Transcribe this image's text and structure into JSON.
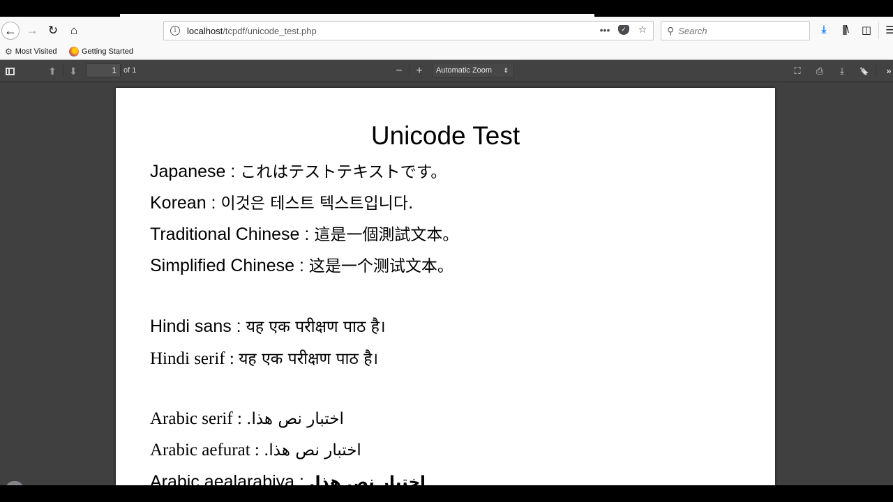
{
  "browser": {
    "url_host": "localhost",
    "url_path": "/tcpdf/unicode_test.php",
    "search_placeholder": "Search",
    "icons": {
      "back": "←",
      "forward": "→",
      "reload": "↻",
      "home": "⌂",
      "page_actions": "•••",
      "pocket": "✓",
      "star": "☆",
      "search": "⚲",
      "download": "⤓",
      "library": "|||\\",
      "sidebar": "◫",
      "menu": "☰"
    },
    "bookmarks": [
      {
        "label": "Most Visited",
        "icon": "⚙"
      },
      {
        "label": "Getting Started",
        "icon": "firefox"
      }
    ]
  },
  "pdf_viewer": {
    "page_number": "1",
    "page_count_label": "of 1",
    "zoom_label": "Automatic Zoom",
    "icons": {
      "prev": "⬆",
      "next": "⬇",
      "zoom_out": "−",
      "zoom_in": "+",
      "zoom_arrows": "⇕",
      "presentation": "⛶",
      "print": "⎙",
      "save": "⤓",
      "bookmark": "🔖",
      "tools": "»"
    }
  },
  "document": {
    "title": "Unicode Test",
    "lines": [
      {
        "label": "Japanese : ",
        "text": "これはテストテキストです。"
      },
      {
        "label": "Korean : ",
        "text": "이것은 테스트 텍스트입니다."
      },
      {
        "label": "Traditional Chinese : ",
        "text": "這是一個測試文本。"
      },
      {
        "label": "Simplified Chinese : ",
        "text": "这是一个测试文本。"
      },
      {
        "label": "Hindi sans : ",
        "text": "यह एक परीक्षण पाठ है।"
      },
      {
        "label": "Hindi serif : ",
        "text": "यह एक परीक्षण पाठ है।"
      },
      {
        "label": "Arabic serif : ",
        "text": "اختبار نص هذا."
      },
      {
        "label": "Arabic aefurat : ",
        "text": "اختبار نص هذا."
      },
      {
        "label": "Arabic aealarabiya : ",
        "text": "اختبار نص هذا."
      }
    ]
  }
}
